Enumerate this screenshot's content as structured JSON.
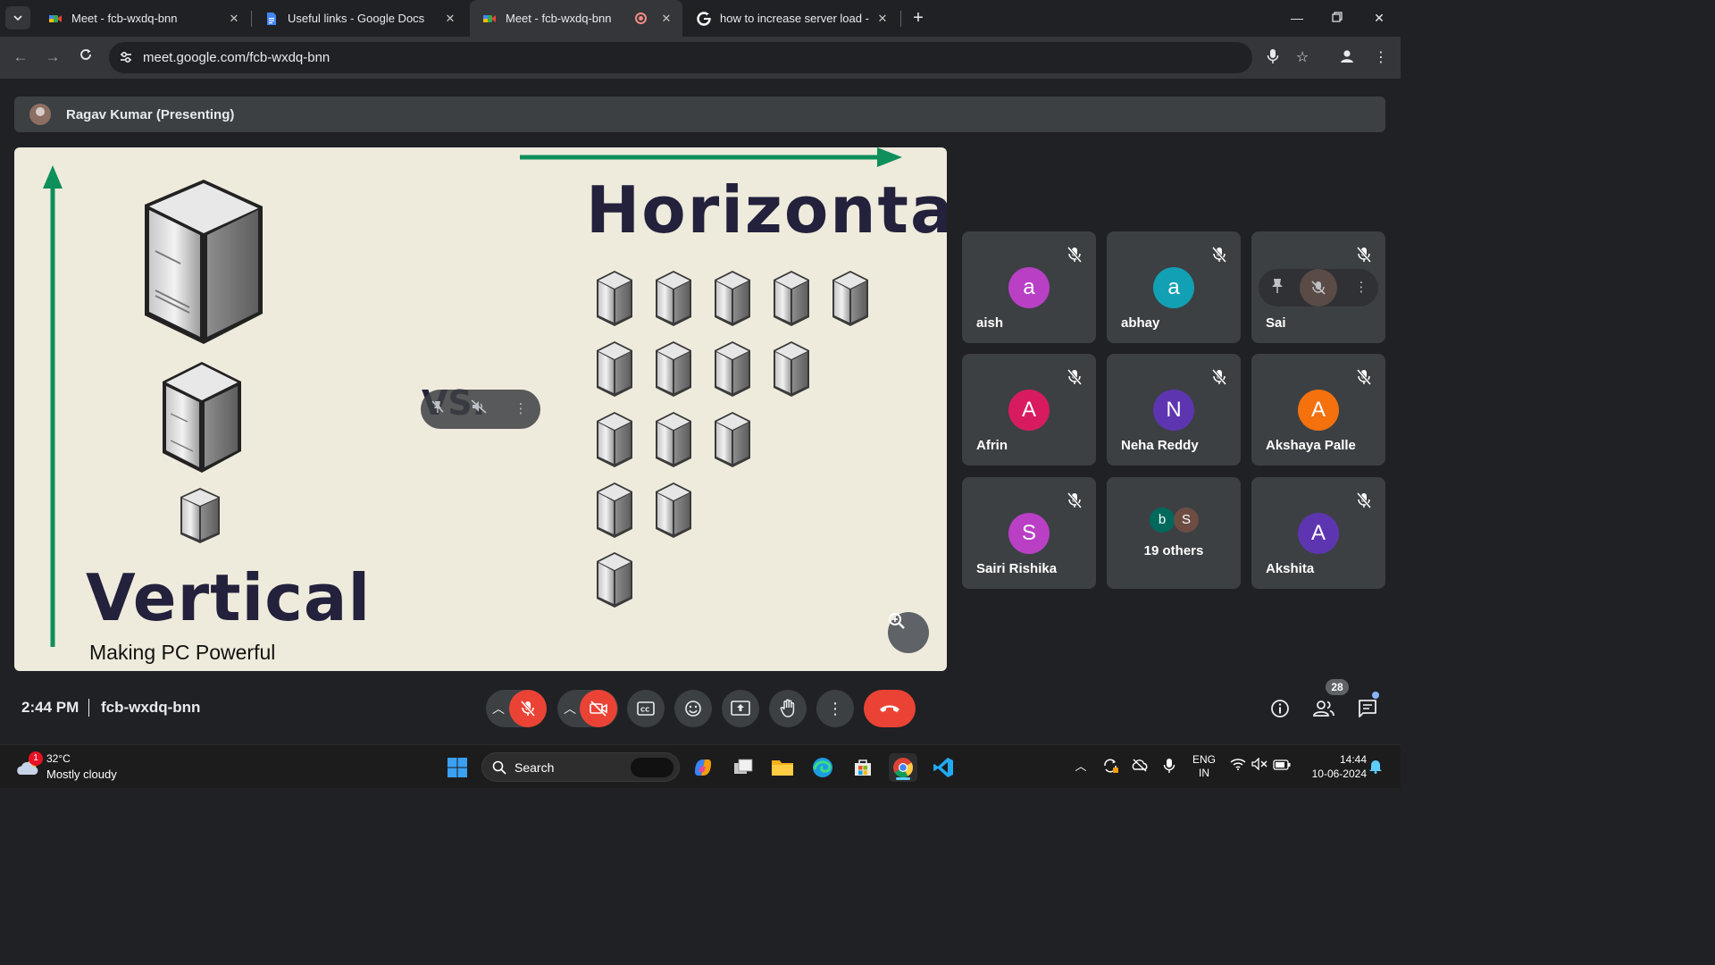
{
  "browser": {
    "tabs": [
      {
        "title": "Meet - fcb-wxdq-bnn",
        "icon": "google-meet-icon",
        "active": false
      },
      {
        "title": "Useful links - Google Docs",
        "icon": "google-docs-icon",
        "active": false
      },
      {
        "title": "Meet - fcb-wxdq-bnn",
        "icon": "google-meet-icon",
        "active": true,
        "recording": true
      },
      {
        "title": "how to increase server load - G",
        "icon": "google-icon",
        "active": false
      }
    ],
    "url": "meet.google.com/fcb-wxdq-bnn"
  },
  "meet": {
    "presenter_label": "Ragav Kumar (Presenting)",
    "slide": {
      "title_horizontal": "Horizontal",
      "title_vertical": "Vertical",
      "subtitle": "Making PC Powerful",
      "vs_text": "VS."
    },
    "participants": [
      {
        "name": "aish",
        "initial": "a",
        "color": "#b93fc5",
        "muted": true
      },
      {
        "name": "abhay",
        "initial": "a",
        "color": "#12a0b4",
        "muted": true
      },
      {
        "name": "Sai",
        "initial": "",
        "color": "#3c4043",
        "muted": true,
        "hovered": true
      },
      {
        "name": "Afrin",
        "initial": "A",
        "color": "#d81b60",
        "muted": true
      },
      {
        "name": "Neha Reddy",
        "initial": "N",
        "color": "#5e35b1",
        "muted": true
      },
      {
        "name": "Akshaya Palle",
        "initial": "A",
        "color": "#f4710e",
        "muted": true
      },
      {
        "name": "Sairi Rishika",
        "initial": "S",
        "color": "#b93fc5",
        "muted": true
      },
      {
        "name": "Akshita",
        "initial": "A",
        "color": "#5e35b1",
        "muted": true
      }
    ],
    "others_tile": {
      "label": "19 others",
      "avatars": [
        {
          "initial": "b",
          "color": "#00695c"
        },
        {
          "initial": "S",
          "color": "#6d4c41"
        }
      ]
    },
    "time": "2:44 PM",
    "meeting_code": "fcb-wxdq-bnn",
    "people_count": "28"
  },
  "taskbar": {
    "weather_badge": "1",
    "temperature": "32°C",
    "weather": "Mostly cloudy",
    "search_label": "Search",
    "lang_line1": "ENG",
    "lang_line2": "IN",
    "clock_time": "14:44",
    "clock_date": "10-06-2024"
  }
}
